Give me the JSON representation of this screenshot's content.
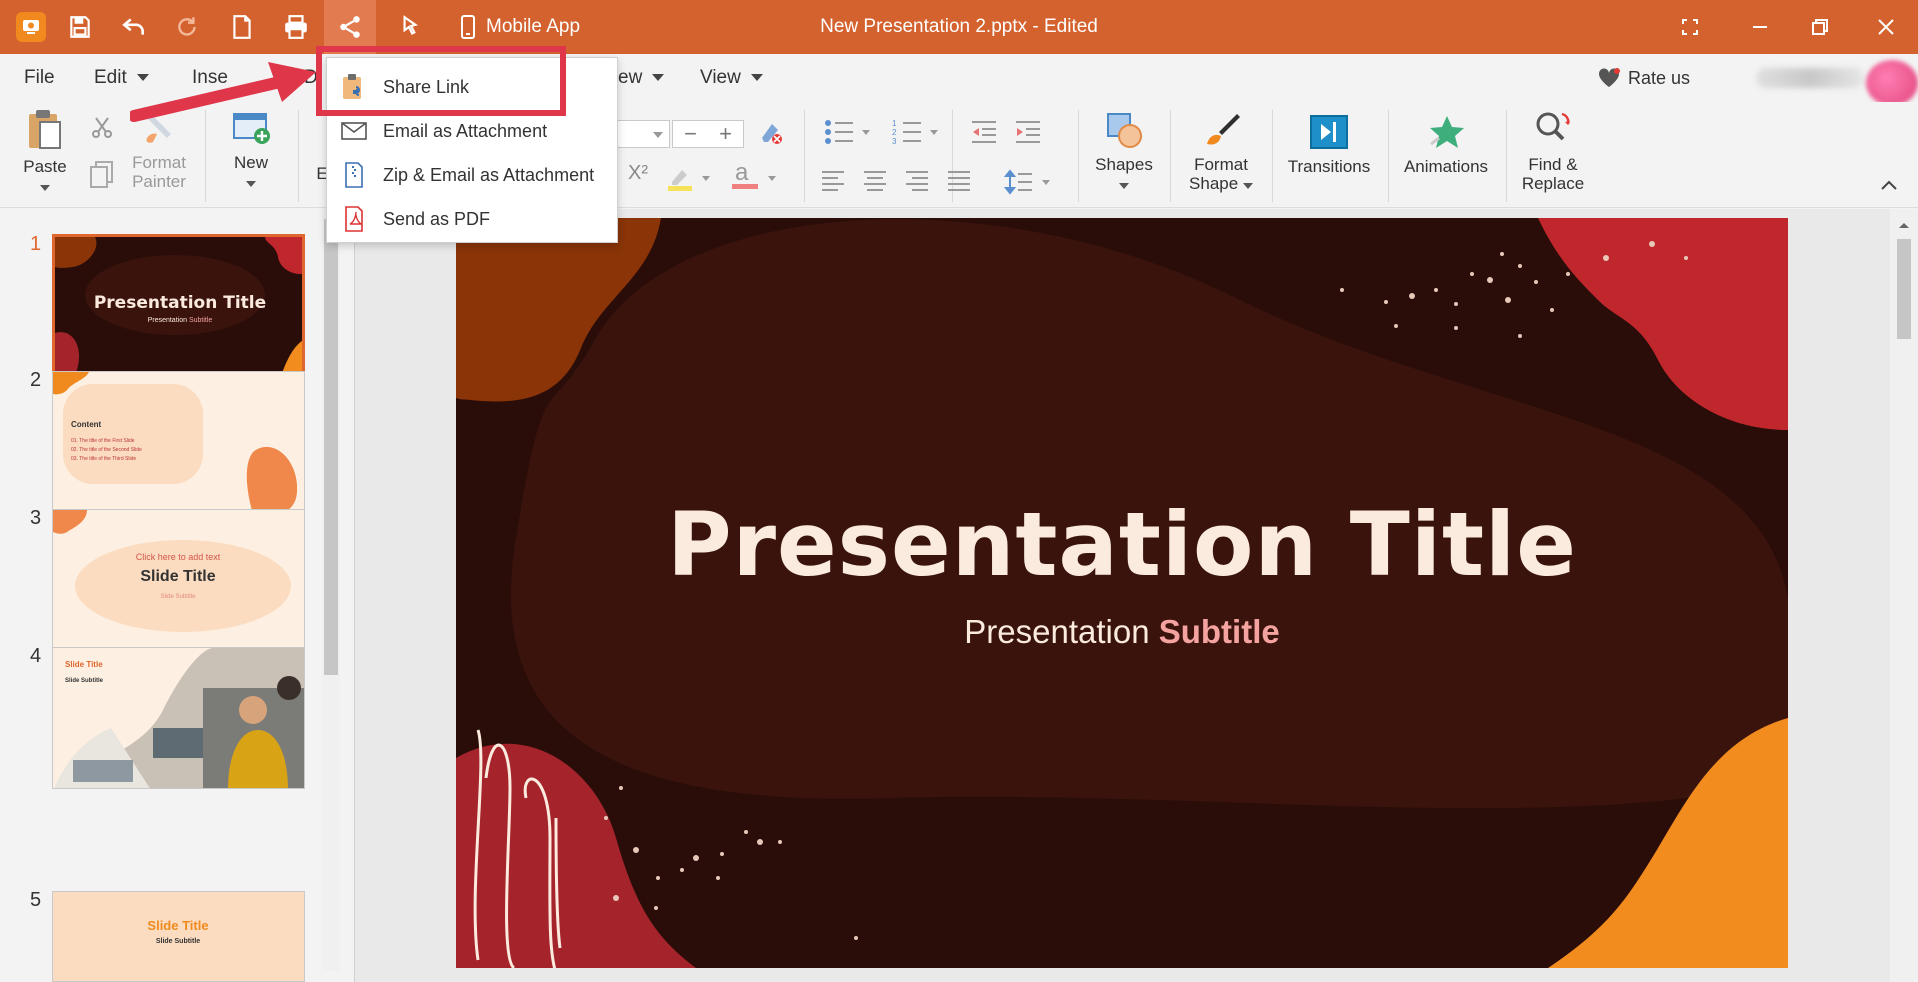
{
  "titlebar": {
    "mobile_app_label": "Mobile App",
    "document_title": "New Presentation 2.pptx - Edited",
    "background_color": "#d4622e"
  },
  "menubar": {
    "items": [
      "File",
      "Edit",
      "Inse",
      "D",
      "ew",
      "View"
    ],
    "rate_us": "Rate us"
  },
  "ribbon": {
    "paste": "Paste",
    "format_painter_line1": "Format",
    "format_painter_line2": "Painter",
    "new": "New",
    "partial_e": "E",
    "shapes": "Shapes",
    "format_shape_line1": "Format",
    "format_shape_line2": "Shape",
    "transitions": "Transitions",
    "animations": "Animations",
    "find_replace_line1": "Find &",
    "find_replace_line2": "Replace",
    "superscript": "X²"
  },
  "share_menu": {
    "items": [
      {
        "label": "Share Link",
        "icon": "share-link-icon"
      },
      {
        "label": "Email as Attachment",
        "icon": "email-icon"
      },
      {
        "label": "Zip & Email as Attachment",
        "icon": "zip-icon"
      },
      {
        "label": "Send as PDF",
        "icon": "pdf-icon"
      }
    ]
  },
  "slides": {
    "numbers": [
      "1",
      "2",
      "3",
      "4",
      "5"
    ],
    "thumb1": {
      "title": "Presentation Title",
      "subtitle_a": "Presentation ",
      "subtitle_b": "Subtitle"
    },
    "thumb2": {
      "heading": "Content",
      "line1": "01. The title of the First Slide",
      "line2": "02. The title of the Second Slide",
      "line3": "03. The title of the Third Slide"
    },
    "thumb3": {
      "hint": "Click here to add text",
      "title": "Slide Title",
      "subtitle": "Slide Subtitle"
    },
    "thumb4": {
      "title": "Slide Title",
      "subtitle": "Slide Subtitle"
    },
    "thumb5": {
      "title": "Slide Title",
      "subtitle": "Slide Subtitle"
    }
  },
  "main_slide": {
    "title": "Presentation Title",
    "subtitle_plain": "Presentation ",
    "subtitle_accent": "Subtitle"
  }
}
